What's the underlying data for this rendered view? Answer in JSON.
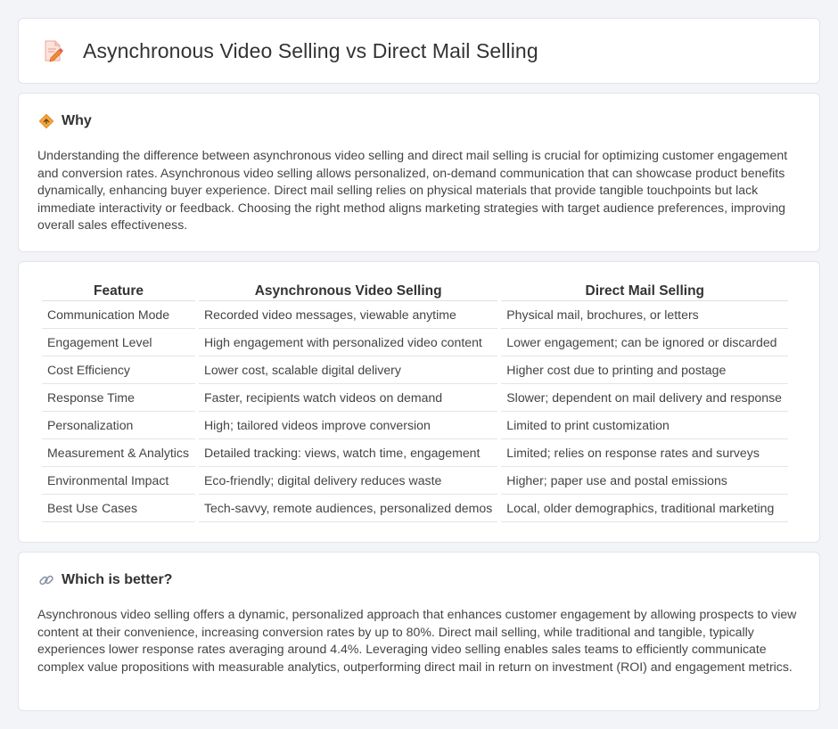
{
  "page": {
    "title": "Asynchronous Video Selling vs Direct Mail Selling",
    "title_icon": "document-pencil-icon"
  },
  "why": {
    "icon": "diamond-sign-icon",
    "heading": "Why",
    "body": "Understanding the difference between asynchronous video selling and direct mail selling is crucial for optimizing customer engagement and conversion rates. Asynchronous video selling allows personalized, on-demand communication that can showcase product benefits dynamically, enhancing buyer experience. Direct mail selling relies on physical materials that provide tangible touchpoints but lack immediate interactivity or feedback. Choosing the right method aligns marketing strategies with target audience preferences, improving overall sales effectiveness."
  },
  "comparison": {
    "headers": [
      "Feature",
      "Asynchronous Video Selling",
      "Direct Mail Selling"
    ],
    "rows": [
      [
        "Communication Mode",
        "Recorded video messages, viewable anytime",
        "Physical mail, brochures, or letters"
      ],
      [
        "Engagement Level",
        "High engagement with personalized video content",
        "Lower engagement; can be ignored or discarded"
      ],
      [
        "Cost Efficiency",
        "Lower cost, scalable digital delivery",
        "Higher cost due to printing and postage"
      ],
      [
        "Response Time",
        "Faster, recipients watch videos on demand",
        "Slower; dependent on mail delivery and response"
      ],
      [
        "Personalization",
        "High; tailored videos improve conversion",
        "Limited to print customization"
      ],
      [
        "Measurement & Analytics",
        "Detailed tracking: views, watch time, engagement",
        "Limited; relies on response rates and surveys"
      ],
      [
        "Environmental Impact",
        "Eco-friendly; digital delivery reduces waste",
        "Higher; paper use and postal emissions"
      ],
      [
        "Best Use Cases",
        "Tech-savvy, remote audiences, personalized demos",
        "Local, older demographics, traditional marketing"
      ]
    ]
  },
  "better": {
    "icon": "link-icon",
    "heading": "Which is better?",
    "body": "Asynchronous video selling offers a dynamic, personalized approach that enhances customer engagement by allowing prospects to view content at their convenience, increasing conversion rates by up to 80%. Direct mail selling, while traditional and tangible, typically experiences lower response rates averaging around 4.4%. Leveraging video selling enables sales teams to efficiently communicate complex value propositions with measurable analytics, outperforming direct mail in return on investment (ROI) and engagement metrics."
  },
  "colors": {
    "page_background": "#f3f4f8",
    "card_background": "#ffffff",
    "accent_orange": "#f0a030",
    "accent_pink": "#e86a6a"
  }
}
